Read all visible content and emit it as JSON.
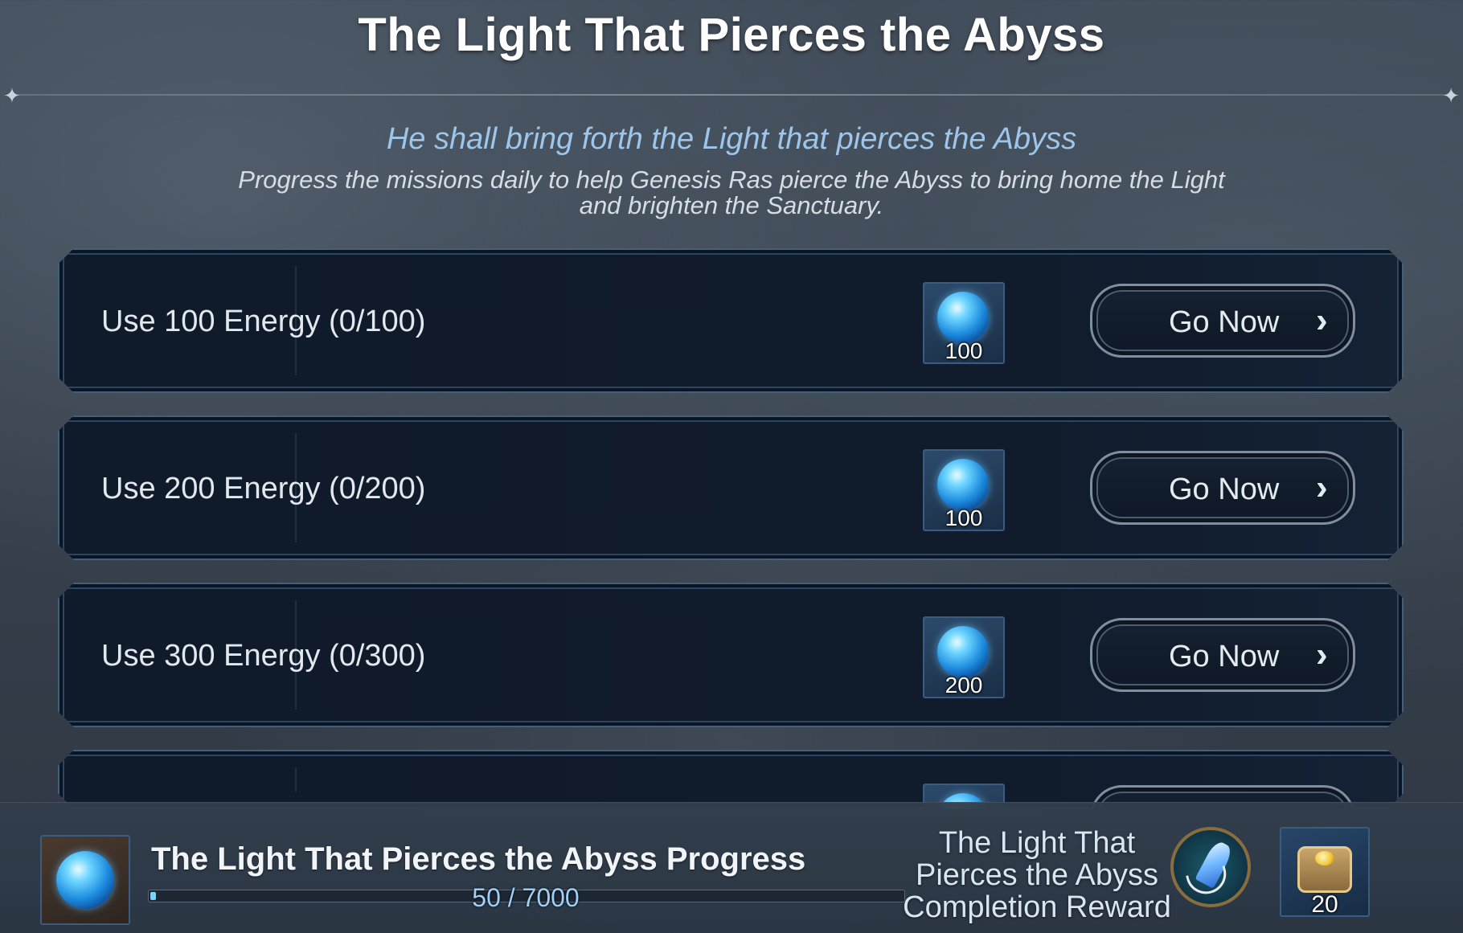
{
  "header": {
    "title": "The Light That Pierces the Abyss",
    "subtitle": "He shall bring forth the Light that pierces the Abyss",
    "description": "Progress the missions daily to help Genesis Ras pierce the Abyss to bring home the Light and brighten the Sanctuary."
  },
  "missions": [
    {
      "label": "Use 100 Energy (0/100)",
      "reward_count": "100",
      "button_label": "Go Now"
    },
    {
      "label": "Use 200 Energy (0/200)",
      "reward_count": "100",
      "button_label": "Go Now"
    },
    {
      "label": "Use 300 Energy (0/300)",
      "reward_count": "200",
      "button_label": "Go Now"
    }
  ],
  "progress_bar": {
    "title": "The Light That Pierces the Abyss Progress",
    "progress_text": "50 / 7000",
    "fraction": 0.00714,
    "completion_reward_label": "The Light That Pierces the Abyss Completion Reward",
    "chest_count": "20"
  },
  "icons": {
    "energy": "blue-energy-orb-icon",
    "medal": "crystal-medal-icon",
    "chest": "gold-chest-icon",
    "chevron": "chevron-right-icon"
  },
  "colors": {
    "accent_blue": "#9ec5ea",
    "progress_fill": "#6fd6ff",
    "panel_bg": "#101b2b"
  }
}
